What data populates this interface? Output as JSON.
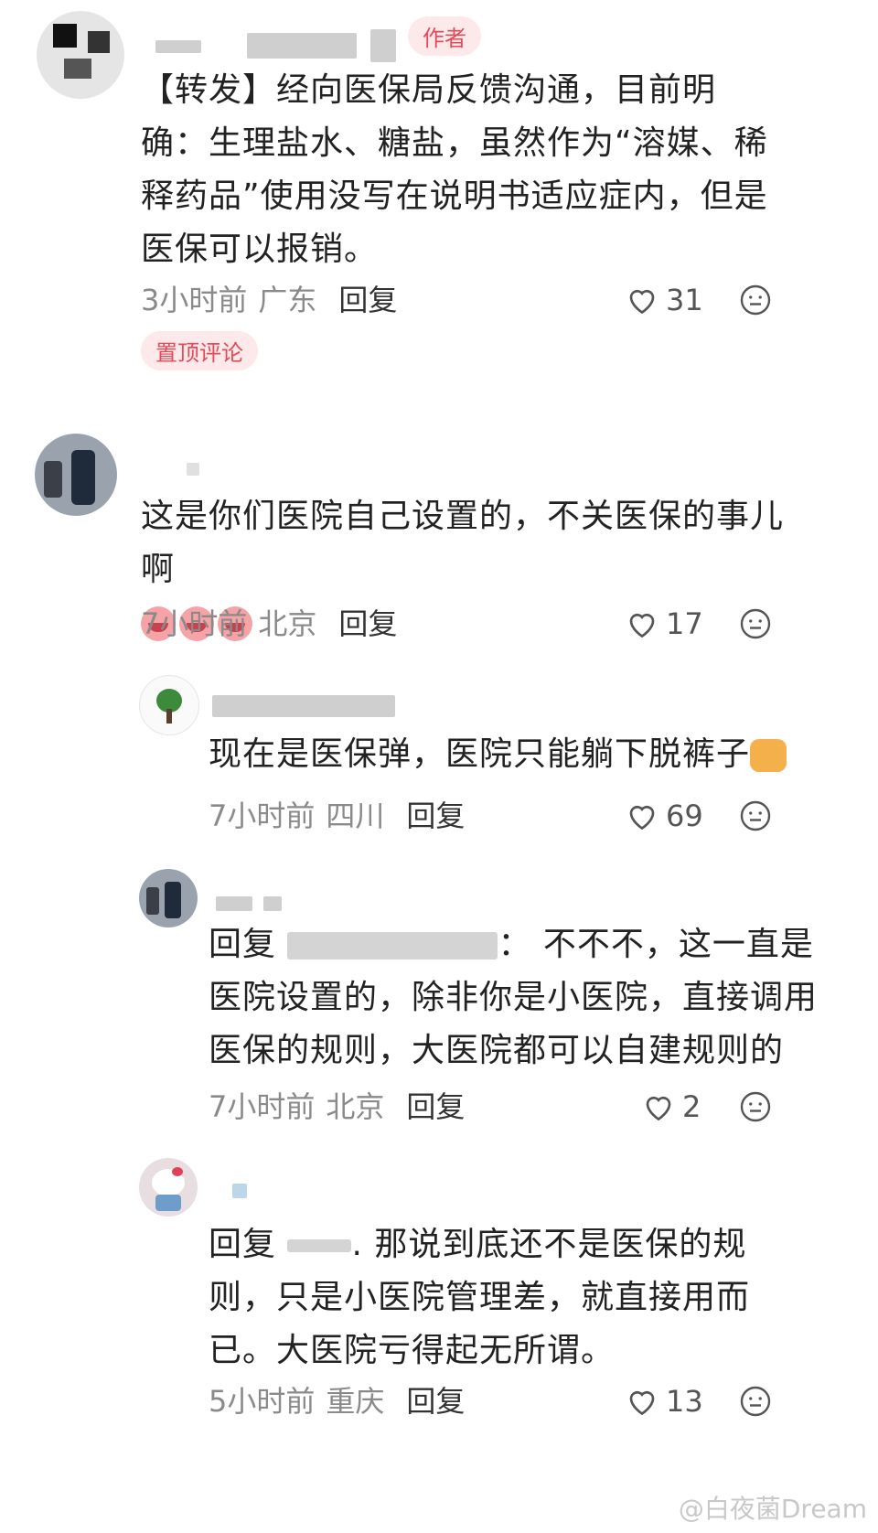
{
  "comments": [
    {
      "author_badge": "作者",
      "text": "【转发】经向医保局反馈沟通，目前明确：生理盐水、糖盐，虽然作为“溶媒、稀释药品”使用没写在说明书适应症内，但是医保可以报销。",
      "time": "3小时前",
      "location": "广东",
      "reply_label": "回复",
      "likes": "31",
      "pinned_label": "置顶评论"
    },
    {
      "text": "这是你们医院自己设置的，不关医保的事儿啊",
      "time": "7小时前",
      "location": "北京",
      "reply_label": "回复",
      "likes": "17"
    },
    {
      "text": "现在是医保弹，医院只能躺下脱裤子",
      "time": "7小时前",
      "location": "四川",
      "reply_label": "回复",
      "likes": "69"
    },
    {
      "reply_prefix": "回复",
      "text": "不不不，这一直是医院设置的，除非你是小医院，直接调用医保的规则，大医院都可以自建规则的",
      "time": "7小时前",
      "location": "北京",
      "reply_label": "回复",
      "likes": "2"
    },
    {
      "reply_prefix": "回复",
      "text": "那说到底还不是医保的规则，只是小医院管理差，就直接用而已。大医院亏得起无所谓。",
      "time": "5小时前",
      "location": "重庆",
      "reply_label": "回复",
      "likes": "13"
    }
  ],
  "watermark": "@白夜菌Dream",
  "icons": {
    "like": "heart-outline-icon",
    "react": "smiley-face-icon"
  }
}
